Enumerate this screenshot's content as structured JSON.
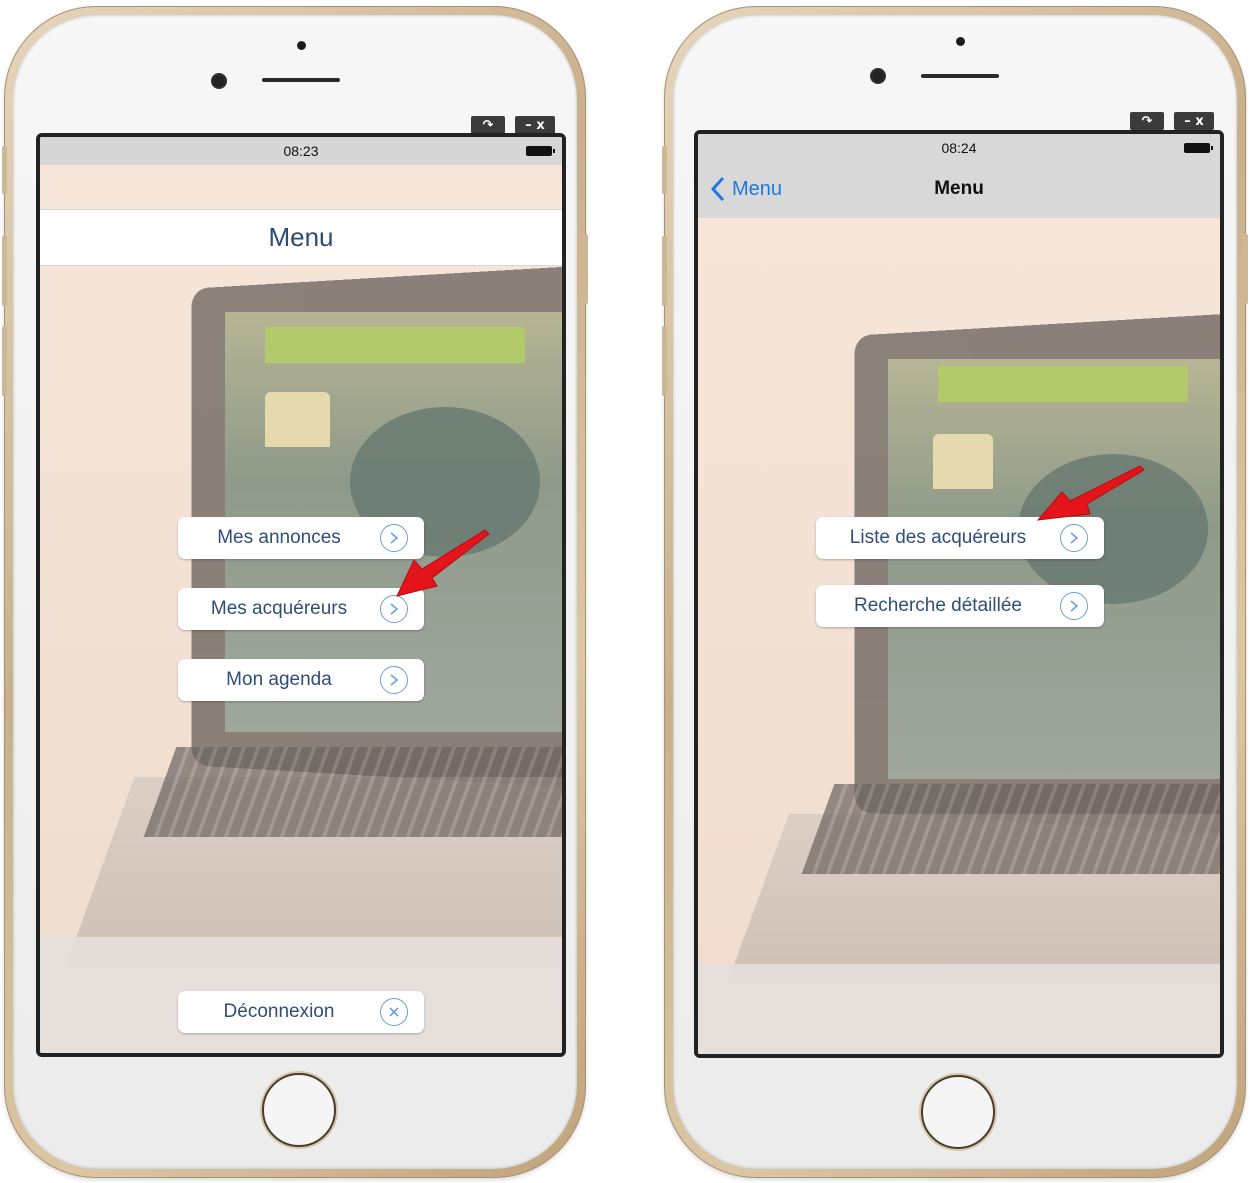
{
  "colors": {
    "accent_blue": "#1f7ae0",
    "button_text": "#2f4e78",
    "annotation_red": "#e4141b",
    "phone_gold": "#d7c3a0"
  },
  "window_controls": {
    "restore_glyph": "↷",
    "minimize_glyph": "–",
    "close_glyph": "x"
  },
  "phone_left": {
    "status_time": "08:23",
    "title": "Menu",
    "buttons": [
      {
        "label": "Mes annonces",
        "icon": "chevron-circle-icon"
      },
      {
        "label": "Mes acquéreurs",
        "icon": "chevron-circle-icon"
      },
      {
        "label": "Mon agenda",
        "icon": "chevron-circle-icon"
      }
    ],
    "logout": {
      "label": "Déconnexion",
      "icon": "close-circle-icon"
    }
  },
  "phone_right": {
    "status_time": "08:24",
    "nav_back_label": "Menu",
    "nav_title": "Menu",
    "buttons": [
      {
        "label": "Liste des acquéreurs",
        "icon": "chevron-circle-icon"
      },
      {
        "label": "Recherche détaillée",
        "icon": "chevron-circle-icon"
      }
    ]
  }
}
